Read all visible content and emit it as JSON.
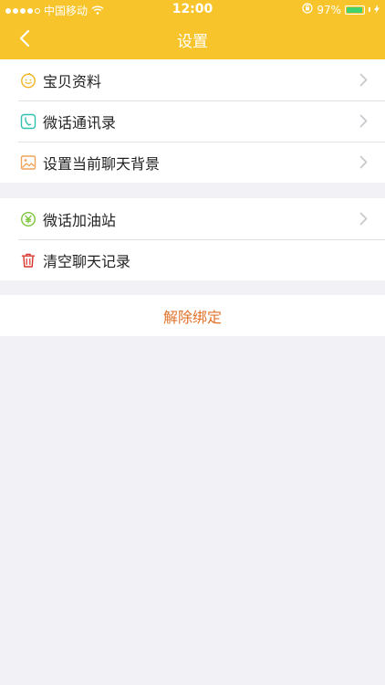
{
  "status_bar": {
    "carrier": "中国移动",
    "time": "12:00",
    "battery_text": "97%",
    "battery_level": 0.97
  },
  "nav": {
    "title": "设置"
  },
  "colors": {
    "header": "#f7c52b",
    "accent_text": "#e2722a",
    "battery_fill": "#3fd26d"
  },
  "groups": [
    {
      "items": [
        {
          "label": "宝贝资料",
          "icon": "baby-face-icon",
          "chevron": true
        },
        {
          "label": "微话通讯录",
          "icon": "phone-icon",
          "chevron": true
        },
        {
          "label": "设置当前聊天背景",
          "icon": "image-icon",
          "chevron": true
        }
      ]
    },
    {
      "items": [
        {
          "label": "微话加油站",
          "icon": "yuan-coin-icon",
          "chevron": true
        },
        {
          "label": "清空聊天记录",
          "icon": "trash-icon",
          "chevron": false
        }
      ]
    }
  ],
  "unbind": {
    "label": "解除绑定"
  }
}
